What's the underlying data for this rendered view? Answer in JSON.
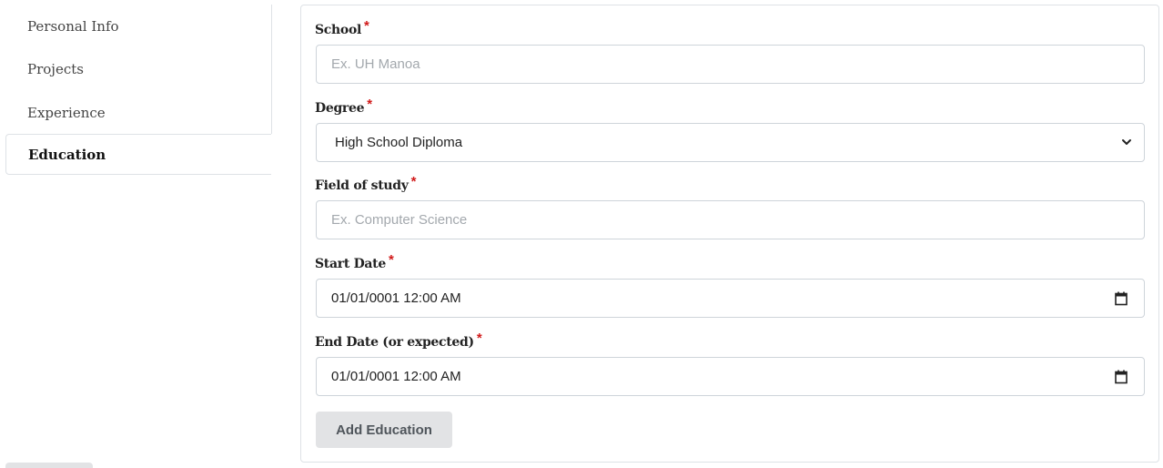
{
  "sidebar": {
    "items": [
      {
        "label": "Personal Info"
      },
      {
        "label": "Projects"
      },
      {
        "label": "Experience"
      },
      {
        "label": "Education"
      }
    ],
    "active_index": 3
  },
  "form": {
    "required_marker": "*",
    "school": {
      "label": "School",
      "placeholder": "Ex. UH Manoa",
      "value": ""
    },
    "degree": {
      "label": "Degree",
      "value": "High School Diploma"
    },
    "field_of_study": {
      "label": "Field of study",
      "placeholder": "Ex. Computer Science",
      "value": ""
    },
    "start_date": {
      "label": "Start Date",
      "value": "01/01/0001 12:00 AM"
    },
    "end_date": {
      "label": "End Date (or expected)",
      "value": "01/01/0001 12:00 AM"
    },
    "submit_label": "Add Education"
  },
  "icons": {
    "select_arrow": "chevron-down-icon",
    "date_picker": "calendar-icon"
  },
  "colors": {
    "required": "#d11a1a",
    "button_bg": "#e2e3e5",
    "border": "#dee2e6"
  }
}
